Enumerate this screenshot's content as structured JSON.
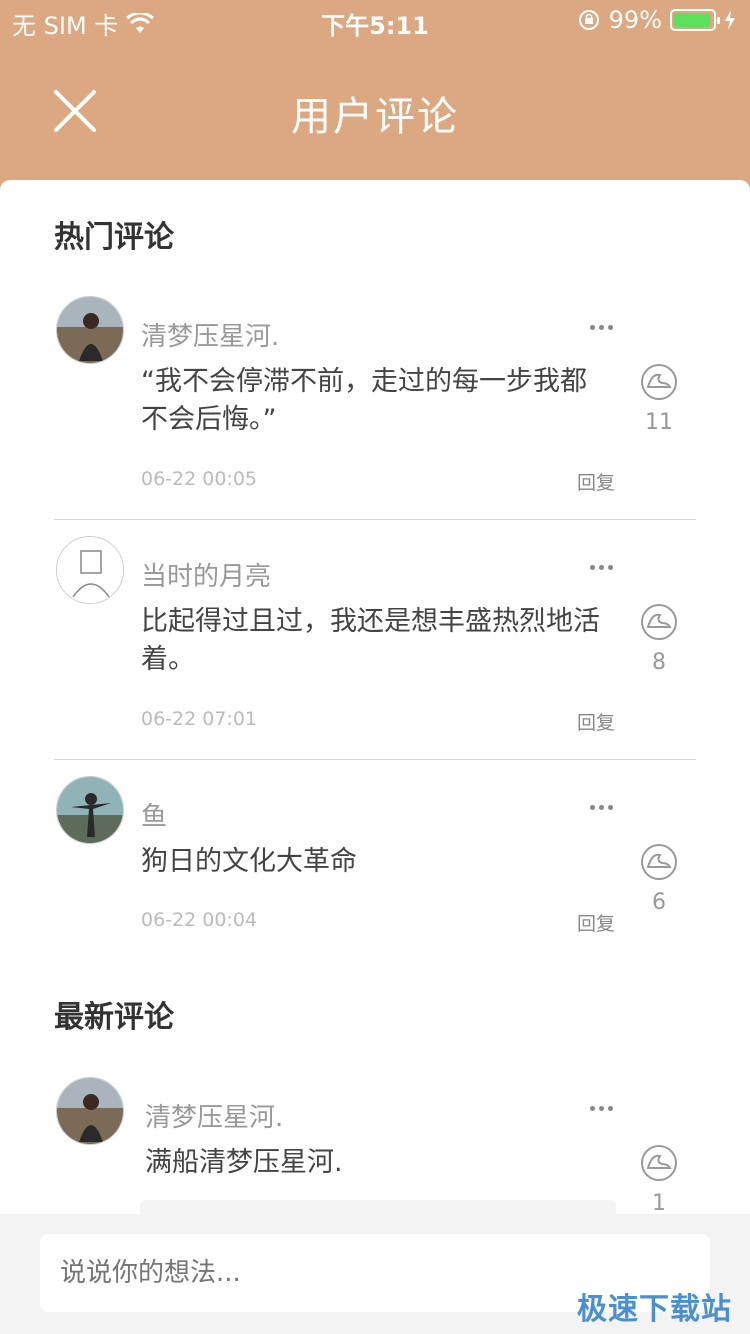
{
  "status_bar": {
    "carrier": "无 SIM 卡",
    "time": "下午5:11",
    "battery": "99%"
  },
  "nav": {
    "title": "用户评论"
  },
  "hot_section": {
    "title": "热门评论",
    "comments": [
      {
        "username": "清梦压星河.",
        "text": "“我不会停滞不前，走过的每一步我都不会后悔。”",
        "time": "06-22 00:05",
        "reply_label": "回复",
        "likes": "11"
      },
      {
        "username": "当时的月亮",
        "text": "比起得过且过，我还是想丰盛热烈地活着。",
        "time": "06-22 07:01",
        "reply_label": "回复",
        "likes": "8"
      },
      {
        "username": "鱼",
        "text": "狗日的文化大革命",
        "time": "06-22 00:04",
        "reply_label": "回复",
        "likes": "6"
      }
    ]
  },
  "new_section": {
    "title": "最新评论",
    "comments": [
      {
        "username": "清梦压星河.",
        "text": "满船清梦压星河.",
        "likes": "1"
      }
    ]
  },
  "input": {
    "placeholder": "说说你的想法..."
  },
  "watermark": "极速下载站",
  "colors": {
    "header": "#dba882",
    "battery": "#5ee25e"
  }
}
